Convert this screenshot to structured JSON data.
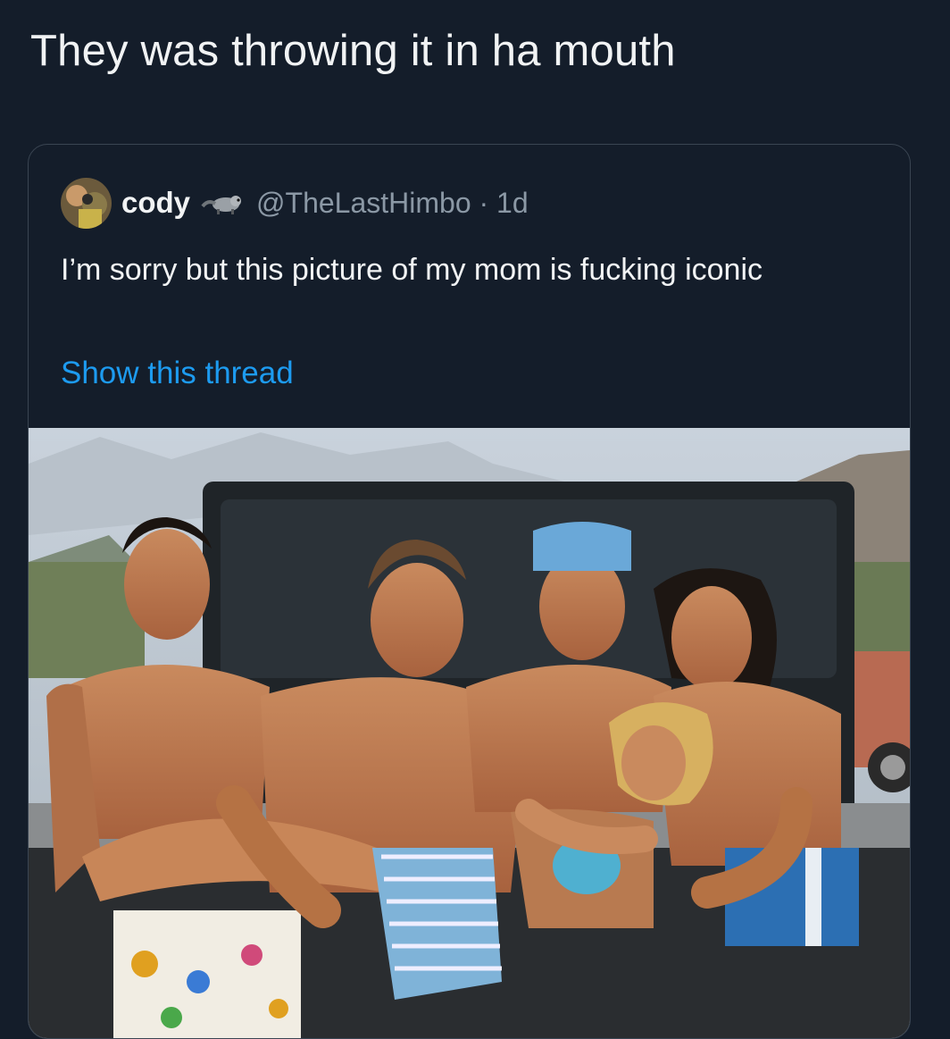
{
  "post": {
    "caption": "They was throwing it in ha mouth"
  },
  "quoted_tweet": {
    "display_name": "cody",
    "handle": "@TheLastHimbo",
    "separator": "·",
    "age": "1d",
    "text": "I’m sorry but this picture of my mom is fucking iconic",
    "show_thread_label": "Show this thread",
    "avatar_icon": "avatar-photo",
    "name_emoji_icon": "raccoon-icon",
    "link_color": "#1d9bf0"
  },
  "media": {
    "type": "photo",
    "photo_description_icon": "group-photo"
  }
}
